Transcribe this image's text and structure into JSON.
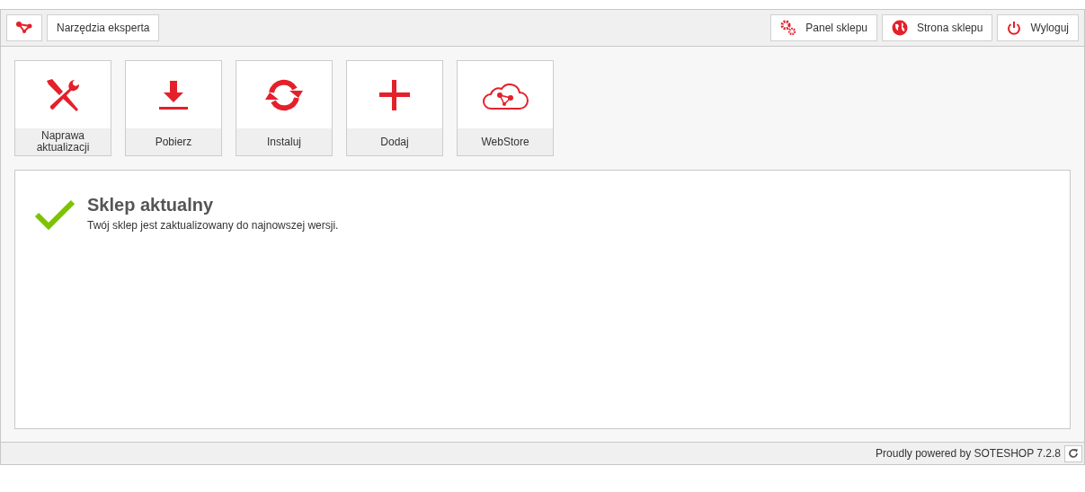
{
  "toolbar": {
    "left": [
      {
        "kind": "logo"
      },
      {
        "kind": "text",
        "label": "Narzędzia eksperta"
      }
    ],
    "right": [
      {
        "kind": "gears",
        "label": "Panel sklepu"
      },
      {
        "kind": "globe",
        "label": "Strona sklepu"
      },
      {
        "kind": "power",
        "label": "Wyloguj"
      }
    ]
  },
  "tiles": [
    {
      "kind": "tools",
      "label": "Naprawa aktualizacji"
    },
    {
      "kind": "download",
      "label": "Pobierz"
    },
    {
      "kind": "sync",
      "label": "Instaluj"
    },
    {
      "kind": "plus",
      "label": "Dodaj"
    },
    {
      "kind": "cloud",
      "label": "WebStore"
    }
  ],
  "status": {
    "title": "Sklep aktualny",
    "message": "Twój sklep jest zaktualizowany do najnowszej wersji."
  },
  "footer": {
    "text": "Proudly powered by SOTESHOP 7.2.8"
  }
}
